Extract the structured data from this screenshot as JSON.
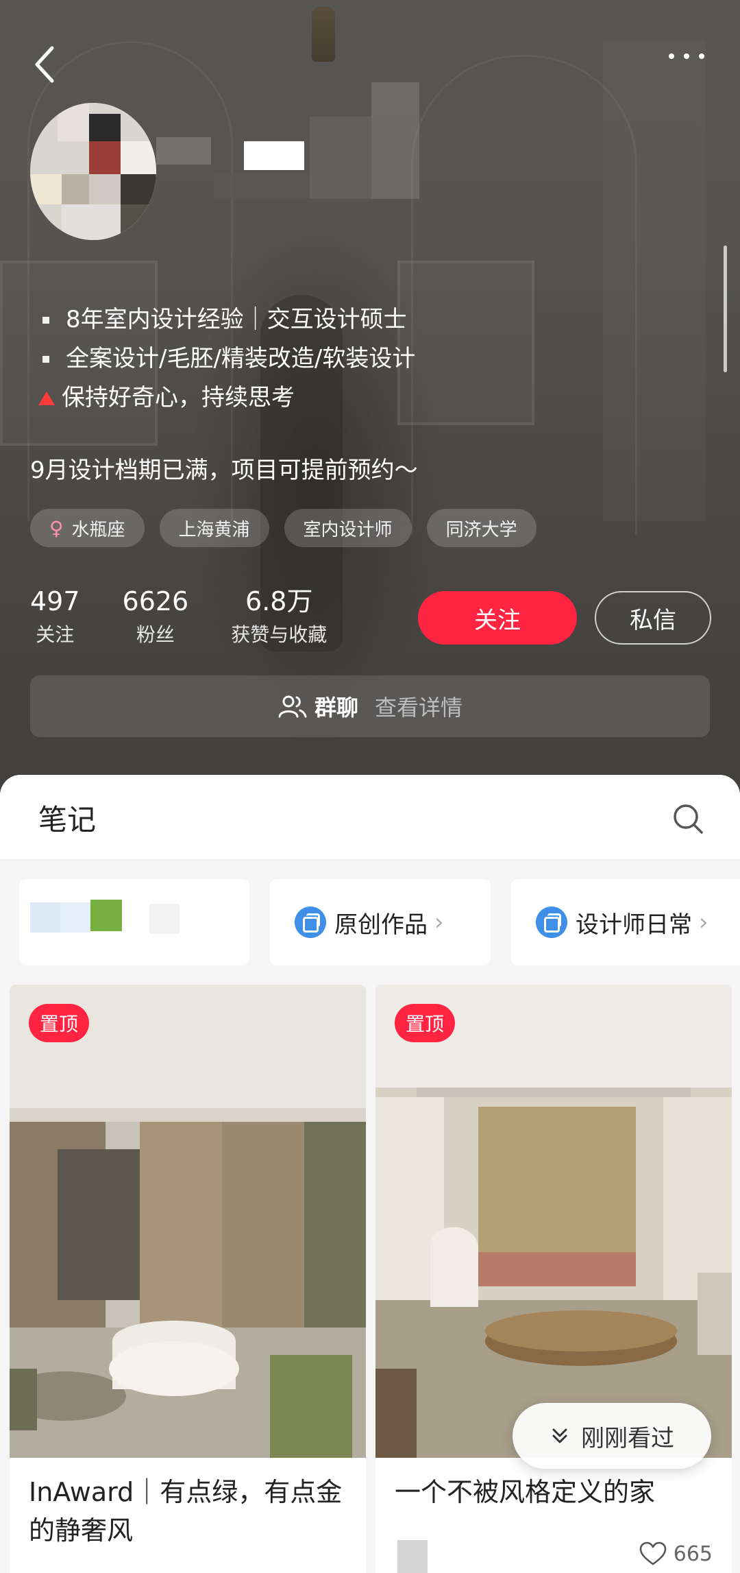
{
  "profile": {
    "bio": [
      {
        "marker": "bullet",
        "text": "8年室内设计经验｜交互设计硕士"
      },
      {
        "marker": "bullet",
        "text": "全案设计/毛胚/精装改造/软装设计"
      },
      {
        "marker": "warning",
        "text": "保持好奇心，持续思考"
      }
    ],
    "notice": "9月设计档期已满，项目可提前预约～",
    "tags": [
      {
        "icon": "female-icon",
        "label": "水瓶座"
      },
      {
        "label": "上海黄浦"
      },
      {
        "label": "室内设计师"
      },
      {
        "label": "同济大学"
      }
    ],
    "stats": [
      {
        "value": "497",
        "label": "关注"
      },
      {
        "value": "6626",
        "label": "粉丝"
      },
      {
        "value": "6.8万",
        "label": "获赞与收藏"
      }
    ],
    "follow_label": "关注",
    "message_label": "私信",
    "group": {
      "title": "群聊",
      "detail": "查看详情"
    }
  },
  "notes": {
    "tab_label": "笔记",
    "collections": [
      {
        "label": "原创作品",
        "icon": "collection-icon"
      },
      {
        "label": "设计师日常",
        "icon": "collection-icon"
      }
    ],
    "cards": [
      {
        "badge": "置顶",
        "title": "InAward｜有点绿，有点金的静奢风"
      },
      {
        "badge": "置顶",
        "title": "一个不被风格定义的家",
        "likes": "665"
      }
    ],
    "recently_viewed_label": "刚刚看过"
  },
  "colors": {
    "accent": "#ff2442",
    "collection_icon": "#3f8fe8"
  }
}
